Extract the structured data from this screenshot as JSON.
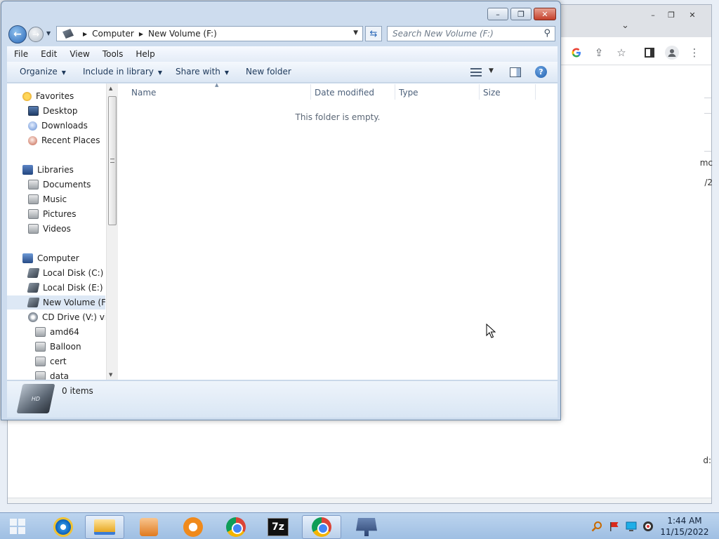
{
  "background_window": {
    "window_buttons": [
      "–",
      "❐",
      "✕"
    ],
    "partial_text": [
      "mc",
      "/2",
      "d:"
    ]
  },
  "explorer": {
    "window_buttons": {
      "minimize": "–",
      "maximize": "❐",
      "close": "✕"
    },
    "address": {
      "segments": [
        "Computer",
        "New Volume (F:)"
      ],
      "separator": "▶"
    },
    "search": {
      "placeholder": "Search New Volume (F:)"
    },
    "menu": [
      "File",
      "Edit",
      "View",
      "Tools",
      "Help"
    ],
    "commands": {
      "organize": "Organize",
      "include_in_library": "Include in library",
      "share_with": "Share with",
      "new_folder": "New folder"
    },
    "nav": {
      "favorites": {
        "label": "Favorites",
        "items": [
          "Desktop",
          "Downloads",
          "Recent Places"
        ]
      },
      "libraries": {
        "label": "Libraries",
        "items": [
          "Documents",
          "Music",
          "Pictures",
          "Videos"
        ]
      },
      "computer": {
        "label": "Computer",
        "items": [
          "Local Disk (C:)",
          "Local Disk (E:)",
          "New Volume (F:)",
          "CD Drive (V:) virti"
        ]
      },
      "cd_children": [
        "amd64",
        "Balloon",
        "cert",
        "data"
      ],
      "selected": "New Volume (F:)"
    },
    "columns": [
      "Name",
      "Date modified",
      "Type",
      "Size"
    ],
    "empty_message": "This folder is empty.",
    "status": {
      "items": "0 items",
      "drive_badge": "HD"
    }
  },
  "taskbar": {
    "apps": [
      "internet-explorer",
      "windows-explorer",
      "media-player",
      "uc-browser",
      "chrome",
      "7-zip",
      "chrome",
      "network"
    ],
    "clock": {
      "time": "1:44 AM",
      "date": "11/15/2022"
    }
  },
  "colors": {
    "accent": "#2a68b8",
    "selected_row": "#dde8f5",
    "taskbar": "#9fbfe3"
  }
}
